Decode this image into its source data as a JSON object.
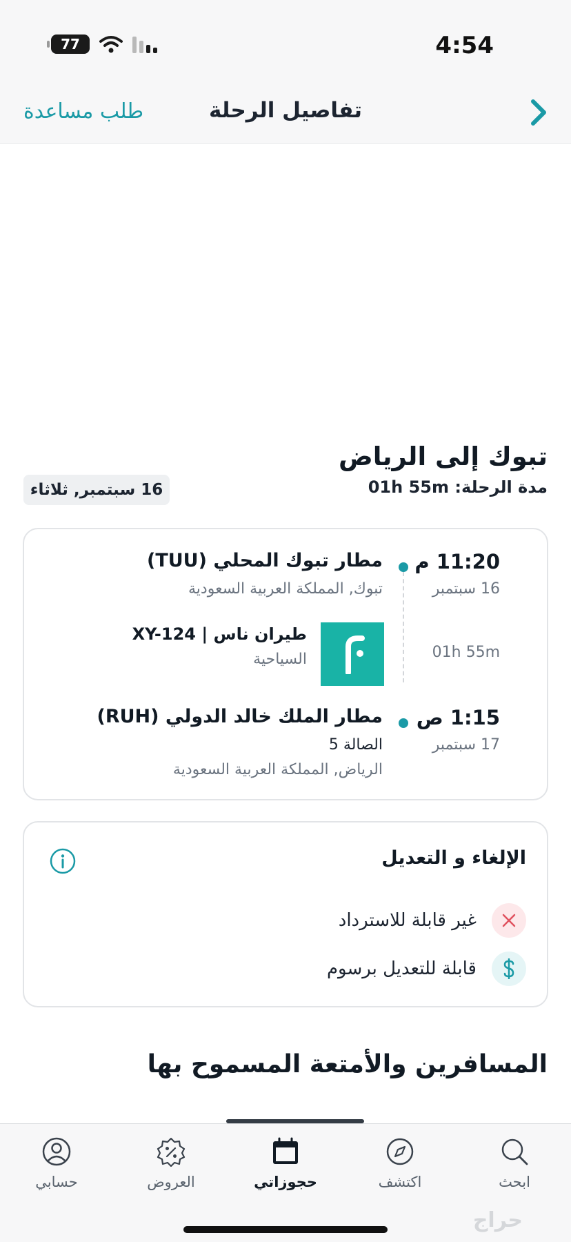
{
  "status": {
    "time": "4:54",
    "battery": "77"
  },
  "header": {
    "title": "تفاصيل الرحلة",
    "help": "طلب مساعدة"
  },
  "trip": {
    "route": "تبوك إلى الرياض",
    "duration_label": "مدة الرحلة: 01h 55m",
    "date_chip": "16 سبتمبر, ثلاثاء"
  },
  "flight": {
    "departure": {
      "time": "11:20 م",
      "date": "16 سبتمبر",
      "airport": "مطار تبوك المحلي (TUU)",
      "location": "تبوك, المملكة العربية السعودية"
    },
    "duration": "01h 55m",
    "airline": {
      "name": "طيران ناس | XY-124",
      "class": "السياحية",
      "logo_color": "#19b3a6"
    },
    "arrival": {
      "time": "1:15 ص",
      "date": "17 سبتمبر",
      "airport": "مطار الملك خالد الدولي (RUH)",
      "terminal": "الصالة 5",
      "location": "الرياض, المملكة العربية السعودية"
    }
  },
  "policy": {
    "title": "الإلغاء و التعديل",
    "items": [
      {
        "label": "غير قابلة للاسترداد",
        "icon": "close-icon"
      },
      {
        "label": "قابلة للتعديل برسوم",
        "icon": "dollar-icon"
      }
    ]
  },
  "passengers": {
    "title": "المسافرين والأمتعة المسموح بها"
  },
  "tabs": [
    {
      "label": "ابحث",
      "icon": "search-icon"
    },
    {
      "label": "اكتشف",
      "icon": "compass-icon"
    },
    {
      "label": "حجوزاتي",
      "icon": "calendar-icon",
      "active": true
    },
    {
      "label": "العروض",
      "icon": "discount-icon"
    },
    {
      "label": "حسابي",
      "icon": "user-icon"
    }
  ],
  "watermark": "حراج",
  "colors": {
    "accent": "#1a9aa6",
    "danger": "#e0525f"
  }
}
